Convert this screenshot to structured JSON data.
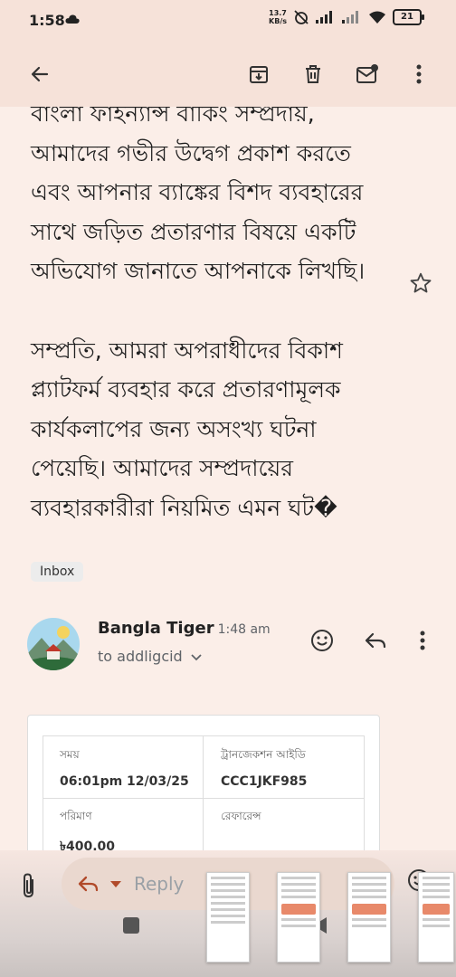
{
  "status": {
    "time": "1:58",
    "net_speed_value": "13.7",
    "net_speed_unit": "KB/s",
    "battery": "21"
  },
  "toolbar": {
    "back_icon": "arrow-left-icon",
    "archive_icon": "archive-icon",
    "delete_icon": "trash-icon",
    "mark_unread_icon": "mail-unread-icon",
    "more_icon": "more-vert-icon"
  },
  "email": {
    "paragraph1": "বাংলা ফাইন্যান্স বাকিং সম্প্রদায়, আমাদের গভীর উদ্বেগ প্রকাশ করতে এবং আপনার ব্যাঙ্কের বিশদ ব্যবহারের সাথে জড়িত প্রতারণার বিষয়ে একটি অভিযোগ জানাতে আপনাকে লিখছি।",
    "paragraph2": "সম্প্রতি, আমরা অপরাধীদের বিকাশ প্ল্যাটফর্ম ব্যবহার করে প্রতারণামূলক কার্যকলাপের জন্য অসংখ্য ঘটনা পেয়েছি। আমাদের সম্প্রদায়ের ব্যবহারকারীরা নিয়মিত এমন ঘট�",
    "label": "Inbox"
  },
  "sender": {
    "name": "Bangla Tiger",
    "time": "1:48 am",
    "to": "to addligcid"
  },
  "transaction": {
    "time_label": "সময়",
    "time_value": "06:01pm 12/03/25",
    "txn_id_label": "ট্রানজেকশন আইডি",
    "txn_id_value": "CCC1JKF985",
    "amount_label": "পরিমাণ",
    "amount_value": "৳400.00",
    "reference_label": "রেফারেন্স"
  },
  "reply_bar": {
    "reply_label": "Reply"
  },
  "colors": {
    "background": "#fbeee8",
    "toolbar": "#f6e2d9",
    "accent": "#e8896a"
  }
}
